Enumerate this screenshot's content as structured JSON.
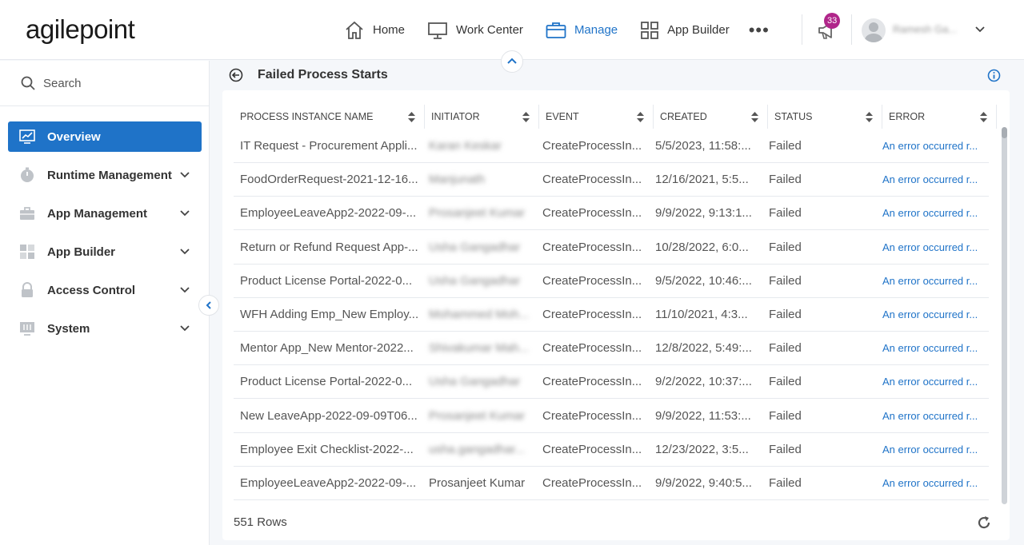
{
  "header": {
    "logo": "agilepoint",
    "nav": [
      {
        "label": "Home",
        "icon": "home-icon"
      },
      {
        "label": "Work Center",
        "icon": "monitor-icon"
      },
      {
        "label": "Manage",
        "icon": "briefcase-icon",
        "active": true
      },
      {
        "label": "App Builder",
        "icon": "grid-icon"
      }
    ],
    "more": "•••",
    "notification_count": "33",
    "user_name": "Ramesh Ga..."
  },
  "sidebar": {
    "search_placeholder": "Search",
    "items": [
      {
        "label": "Overview",
        "icon": "chart-icon",
        "active": true
      },
      {
        "label": "Runtime Management",
        "icon": "stopwatch-icon"
      },
      {
        "label": "App Management",
        "icon": "briefcase-icon"
      },
      {
        "label": "App Builder",
        "icon": "grid-icon"
      },
      {
        "label": "Access Control",
        "icon": "lock-icon"
      },
      {
        "label": "System",
        "icon": "settings-sliders-icon"
      }
    ]
  },
  "page": {
    "title": "Failed Process Starts",
    "row_count": "551 Rows"
  },
  "table": {
    "columns": [
      "PROCESS INSTANCE NAME",
      "INITIATOR",
      "EVENT",
      "CREATED",
      "STATUS",
      "ERROR"
    ],
    "rows": [
      {
        "name": "IT Request - Procurement Appli...",
        "initiator": "Karan Keskar",
        "event": "CreateProcessIn...",
        "created": "5/5/2023, 11:58:...",
        "status": "Failed",
        "error": "An error occurred r...",
        "blur": true
      },
      {
        "name": "FoodOrderRequest-2021-12-16...",
        "initiator": "Manjunath",
        "event": "CreateProcessIn...",
        "created": "12/16/2021, 5:5...",
        "status": "Failed",
        "error": "An error occurred r...",
        "blur": true
      },
      {
        "name": "EmployeeLeaveApp2-2022-09-...",
        "initiator": "Prosanjeet Kumar",
        "event": "CreateProcessIn...",
        "created": "9/9/2022, 9:13:1...",
        "status": "Failed",
        "error": "An error occurred r...",
        "blur": true
      },
      {
        "name": "Return or Refund Request App-...",
        "initiator": "Usha Gangadhar",
        "event": "CreateProcessIn...",
        "created": "10/28/2022, 6:0...",
        "status": "Failed",
        "error": "An error occurred r...",
        "blur": true
      },
      {
        "name": "Product License Portal-2022-0...",
        "initiator": "Usha Gangadhar",
        "event": "CreateProcessIn...",
        "created": "9/5/2022, 10:46:...",
        "status": "Failed",
        "error": "An error occurred r...",
        "blur": true
      },
      {
        "name": "WFH Adding Emp_New Employ...",
        "initiator": "Mohammed Moh...",
        "event": "CreateProcessIn...",
        "created": "11/10/2021, 4:3...",
        "status": "Failed",
        "error": "An error occurred r...",
        "blur": true
      },
      {
        "name": "Mentor App_New Mentor-2022...",
        "initiator": "Shivakumar Mah...",
        "event": "CreateProcessIn...",
        "created": "12/8/2022, 5:49:...",
        "status": "Failed",
        "error": "An error occurred r...",
        "blur": true
      },
      {
        "name": "Product License Portal-2022-0...",
        "initiator": "Usha Gangadhar",
        "event": "CreateProcessIn...",
        "created": "9/2/2022, 10:37:...",
        "status": "Failed",
        "error": "An error occurred r...",
        "blur": true
      },
      {
        "name": "New LeaveApp-2022-09-09T06...",
        "initiator": "Prosanjeet Kumar",
        "event": "CreateProcessIn...",
        "created": "9/9/2022, 11:53:...",
        "status": "Failed",
        "error": "An error occurred r...",
        "blur": true
      },
      {
        "name": "Employee Exit Checklist-2022-...",
        "initiator": "usha.gangadhar...",
        "event": "CreateProcessIn...",
        "created": "12/23/2022, 3:5...",
        "status": "Failed",
        "error": "An error occurred r...",
        "blur": true
      },
      {
        "name": "EmployeeLeaveApp2-2022-09-...",
        "initiator": "Prosanjeet Kumar",
        "event": "CreateProcessIn...",
        "created": "9/9/2022, 9:40:5...",
        "status": "Failed",
        "error": "An error occurred r...",
        "blur": false
      }
    ]
  },
  "colors": {
    "accent": "#1f73c8",
    "badge": "#b0268a"
  }
}
